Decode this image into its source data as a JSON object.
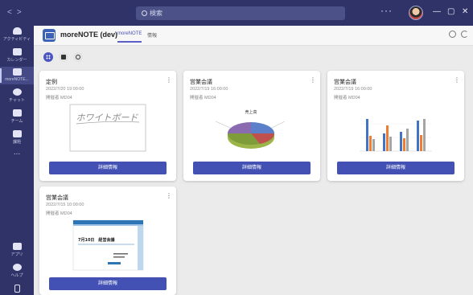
{
  "titlebar": {
    "back_icon": "chevron-left",
    "forward_icon": "chevron-right",
    "search_placeholder": "検索",
    "more_icon": "ellipsis-horizontal",
    "minimize_icon": "minus",
    "maximize_icon": "square",
    "close_icon": "x"
  },
  "rail": {
    "items": [
      {
        "label": "アクティビティ",
        "icon": "bell-icon"
      },
      {
        "label": "カレンダー",
        "icon": "calendar-icon"
      },
      {
        "label": "moreNOTE...",
        "icon": "app-icon"
      },
      {
        "label": "チャット",
        "icon": "chat-icon"
      },
      {
        "label": "チーム",
        "icon": "teams-icon"
      },
      {
        "label": "課題",
        "icon": "assignments-icon"
      }
    ],
    "more": "...",
    "bottom": [
      {
        "label": "アプリ",
        "icon": "apps-icon"
      },
      {
        "label": "ヘルプ",
        "icon": "help-icon"
      }
    ]
  },
  "app": {
    "title": "moreNOTE (dev)",
    "tabs": [
      {
        "label": "moreNOTE",
        "active": true
      },
      {
        "label": "情報",
        "active": false
      }
    ]
  },
  "cards": [
    {
      "title": "定例",
      "date": "2022/7/20 19:00:00",
      "room": "開催者 MD04",
      "thumb": "whiteboard",
      "thumb_text": "ホワイトボード",
      "button": "詳細情報"
    },
    {
      "title": "営業会議",
      "date": "2022/7/19 16:00:00",
      "room": "開催者 MD04",
      "thumb": "pie",
      "thumb_text": "売上高",
      "button": "詳細情報"
    },
    {
      "title": "営業会議",
      "date": "2022/7/19 16:00:00",
      "room": "開催者 MD04",
      "thumb": "bar",
      "thumb_text": "",
      "button": "詳細情報"
    },
    {
      "title": "営業会議",
      "date": "2022/7/15 10:00:00",
      "room": "開催者 MD04",
      "thumb": "slide",
      "thumb_text": "7月10日　経営会議",
      "button": "詳細情報"
    }
  ],
  "colors": {
    "rail_bg": "#2f3368",
    "accent": "#4251b3",
    "series": [
      "#4472c4",
      "#ed7d31",
      "#a5a5a5"
    ]
  }
}
